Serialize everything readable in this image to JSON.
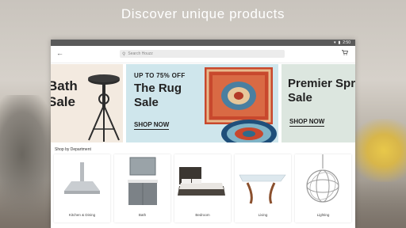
{
  "headline": "Discover unique products",
  "status_bar": {
    "time": "2:50"
  },
  "app_bar": {
    "search_placeholder": "Search Houzz"
  },
  "banners": {
    "bath": {
      "text": "Bath Sale"
    },
    "rug": {
      "eyebrow": "UP TO 75% OFF",
      "title": "The Rug Sale",
      "cta": "SHOP NOW"
    },
    "spring": {
      "title": "Premier Spring Sale",
      "cta": "SHOP NOW"
    }
  },
  "departments": {
    "heading": "Shop by Department",
    "items": [
      {
        "label": "Kitchen & Dining"
      },
      {
        "label": "Bath"
      },
      {
        "label": "Bedroom"
      },
      {
        "label": "Living"
      },
      {
        "label": "Lighting"
      }
    ]
  },
  "colors": {
    "rug_banner_bg": "#cfe6ec",
    "spring_banner_bg": "#dce6df",
    "bath_banner_bg": "#f3eae0"
  }
}
